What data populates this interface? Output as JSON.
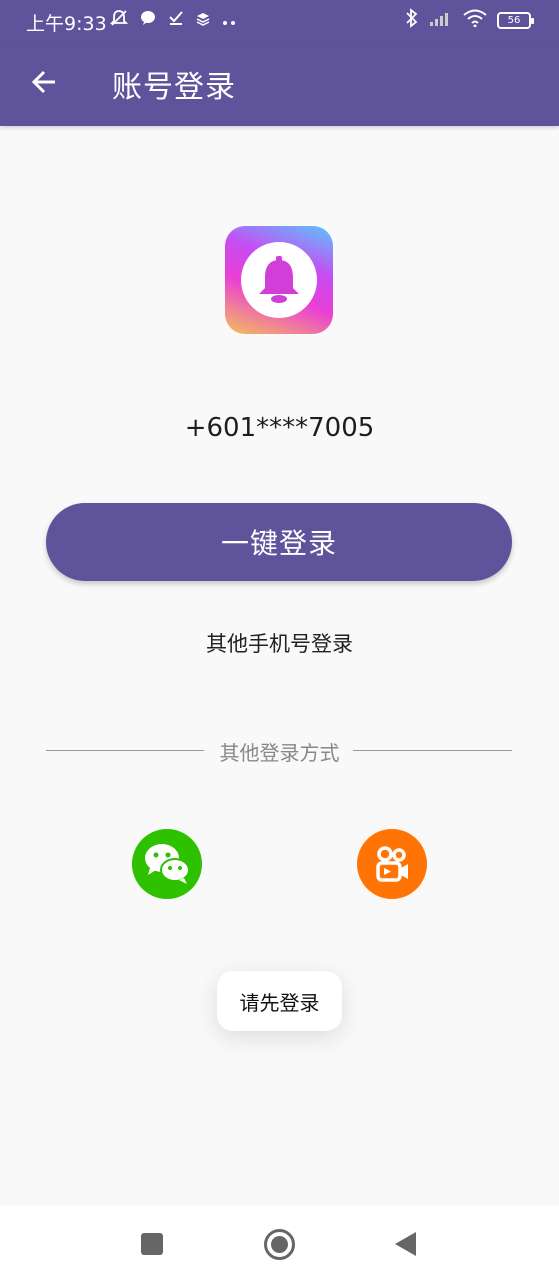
{
  "status_bar": {
    "time": "上午9:33",
    "battery": "56",
    "icons_left": [
      "mute-icon",
      "chat-bubble-icon",
      "check-icon",
      "layers-icon",
      "more-icon"
    ],
    "icons_right": [
      "bluetooth-icon",
      "signal-icon",
      "wifi-icon",
      "battery-icon"
    ]
  },
  "app_bar": {
    "title": "账号登录"
  },
  "login": {
    "phone_number": "+601****7005",
    "one_click_label": "一键登录",
    "other_phone_label": "其他手机号登录",
    "other_methods_label": "其他登录方式"
  },
  "social": {
    "items": [
      "wechat-icon",
      "kuaishou-icon"
    ]
  },
  "toast": {
    "message": "请先登录"
  },
  "colors": {
    "primary": "#5f539b",
    "wechat": "#2dc100",
    "kuaishou": "#ff7404"
  }
}
